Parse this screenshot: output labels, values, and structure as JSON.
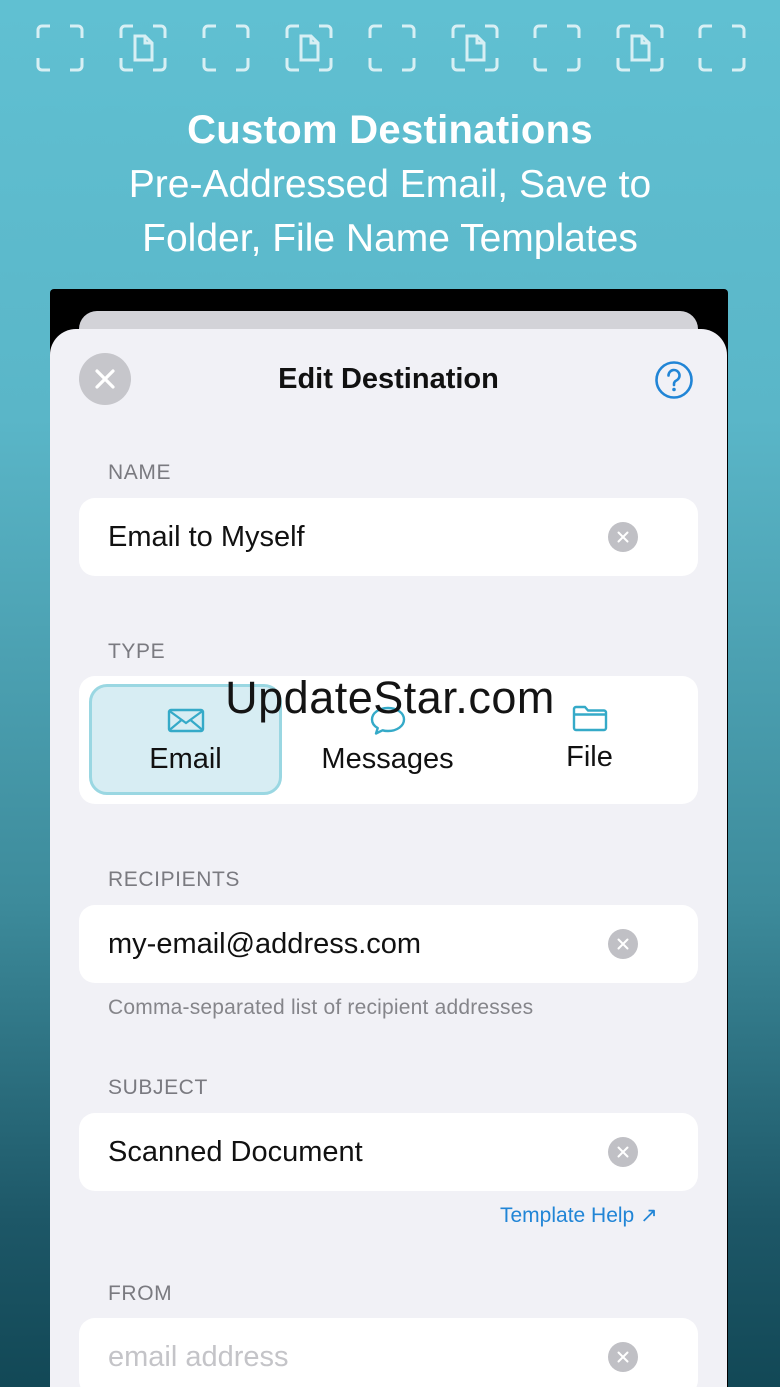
{
  "headline": {
    "title": "Custom Destinations",
    "subtitle_line1": "Pre-Addressed Email, Save to",
    "subtitle_line2": "Folder, File Name Templates"
  },
  "decorations": {
    "frame_icons": [
      "scan-frame-icon",
      "document-frame-icon",
      "scan-frame-icon",
      "document-frame-icon",
      "scan-frame-icon",
      "document-frame-icon",
      "scan-frame-icon",
      "document-frame-icon",
      "scan-frame-icon"
    ]
  },
  "sheet": {
    "title": "Edit Destination",
    "close_icon": "close-icon",
    "help_icon": "question-circle-icon"
  },
  "name": {
    "label": "NAME",
    "value": "Email to Myself"
  },
  "type": {
    "label": "TYPE",
    "options": [
      {
        "label": "Email",
        "icon": "envelope-icon",
        "selected": true
      },
      {
        "label": "Messages",
        "icon": "speech-bubble-icon",
        "selected": false
      },
      {
        "label": "File",
        "icon": "folder-icon",
        "selected": false
      }
    ]
  },
  "recipients": {
    "label": "RECIPIENTS",
    "value": "my-email@address.com",
    "hint": "Comma-separated list of recipient addresses"
  },
  "subject": {
    "label": "SUBJECT",
    "value": "Scanned Document",
    "template_help": "Template Help ↗"
  },
  "from": {
    "label": "FROM",
    "value": "",
    "placeholder": "email address"
  },
  "watermark": "UpdateStar.com",
  "colors": {
    "accent": "#2185d6",
    "selected_bg": "#d7edf3",
    "selected_border": "#9ad7e2",
    "icon_teal": "#35aac8"
  }
}
